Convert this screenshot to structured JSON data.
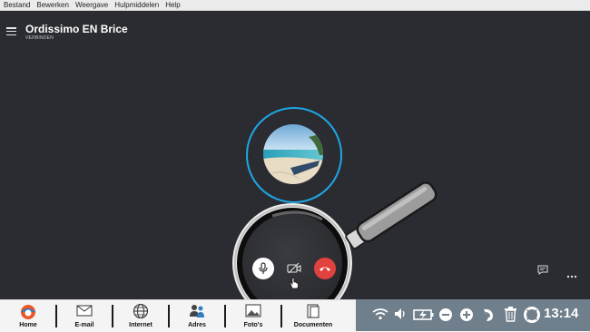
{
  "menubar": {
    "items": [
      "Bestand",
      "Bewerken",
      "Weergave",
      "Hulpmiddelen",
      "Help"
    ]
  },
  "call": {
    "contact_name": "Ordissimo EN Brice",
    "status": "VERBINDEN"
  },
  "controls": {
    "mic": "mic-icon",
    "video": "video-off-icon",
    "hangup": "hangup-icon",
    "chat": "chat-icon",
    "more": "more-icon"
  },
  "taskbar": {
    "items": [
      {
        "label": "Home",
        "icon": "ordissimo-logo-icon"
      },
      {
        "label": "E-mail",
        "icon": "envelope-icon"
      },
      {
        "label": "Internet",
        "icon": "globe-icon"
      },
      {
        "label": "Adres",
        "icon": "contacts-icon"
      },
      {
        "label": "Foto's",
        "icon": "photo-icon"
      },
      {
        "label": "Documenten",
        "icon": "documents-icon"
      }
    ]
  },
  "tray": {
    "icons": [
      "wifi-icon",
      "volume-icon",
      "battery-charging-icon",
      "zoom-out-icon",
      "zoom-in-icon",
      "back-icon",
      "trash-icon",
      "help-lifebuoy-icon"
    ],
    "clock": "13:14"
  },
  "colors": {
    "background": "#2b2c31",
    "ring": "#1ea7e6",
    "hangup": "#e2423d",
    "tray": "#707f8c"
  }
}
